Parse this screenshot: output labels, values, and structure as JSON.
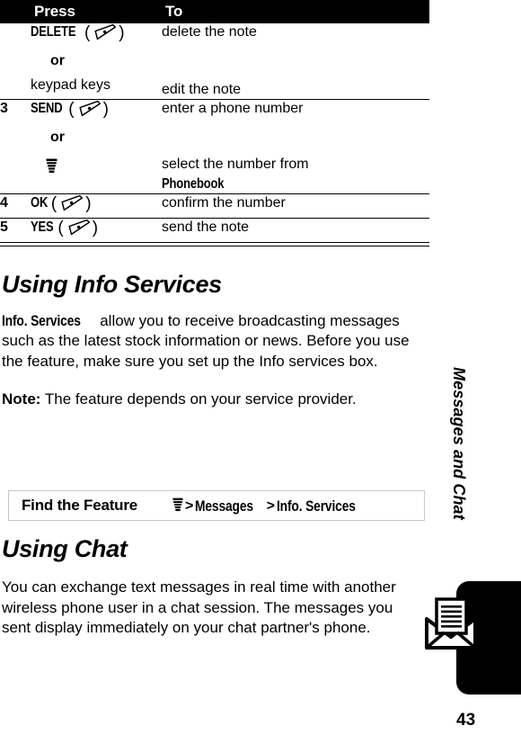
{
  "table": {
    "headers": {
      "num": "",
      "press": "Press",
      "to": "To"
    },
    "rows": [
      {
        "num": "",
        "press_primary": "DELETE",
        "press_has_softkey": true,
        "press_or": "or",
        "press_secondary": "keypad keys",
        "to_primary": "delete the note",
        "to_secondary": "edit the note"
      },
      {
        "num": "3",
        "press_primary": "SEND",
        "press_has_softkey": true,
        "press_or": "or",
        "press_secondary_icon": "menu-icon",
        "to_primary": "enter a phone number",
        "to_secondary": "select the number from",
        "to_secondary_screenword": "Phonebook"
      },
      {
        "num": "4",
        "press_primary": "OK",
        "press_has_softkey": true,
        "to_primary": "confirm the number"
      },
      {
        "num": "5",
        "press_primary": "YES",
        "press_has_softkey": true,
        "to_primary": "send the note"
      }
    ]
  },
  "section_info": {
    "heading": "Using Info Services",
    "para_lead": "Info. Services",
    "para_rest": " allow you to receive broadcasting messages such as the latest stock information or news. Before you use the feature, make sure you set up the Info services box.",
    "note_label": "Note:",
    "note_text": " The feature depends on your service provider."
  },
  "find_the_feature": {
    "label": "Find the Feature",
    "menu_icon": "menu-icon",
    "sep1": ">",
    "path1": "Messages",
    "sep2": ">",
    "path2": "Info. Services"
  },
  "section_chat": {
    "heading": "Using Chat",
    "para": "You can exchange text messages in real time with another wireless phone user in a chat session. The messages you sent display immediately on your chat partner's phone."
  },
  "margin": {
    "running_head": "Messages and Chat",
    "tab_icon": "envelope-message-icon",
    "page_number": "43"
  },
  "colors": {
    "header_bar": "#000000",
    "header_text": "#ffffff",
    "body_text": "#000000",
    "rule": "#000000",
    "box_border": "#c9c9c9"
  }
}
